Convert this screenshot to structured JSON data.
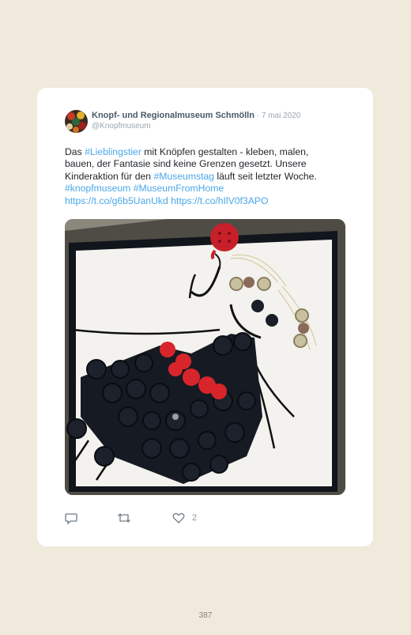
{
  "tweet": {
    "author_name": "Knopf- und Regionalmuseum Schmölln",
    "date_separator": " · ",
    "date": "7 mai 2020",
    "handle": "@Knopfmuseum",
    "text": {
      "l1_a": "Das ",
      "l1_tag": "#Lieblingstier",
      "l1_b": " mit Knöpfen gestalten - kleben, malen,",
      "l2": "bauen, der Fantasie sind keine Grenzen gesetzt. Unsere",
      "l3_a": "Kinderaktion für den ",
      "l3_tag": "#Museumstag",
      "l3_b": " läuft seit letzter Woche.",
      "l4_tag1": "#knopfmuseum",
      "l4_space": " ",
      "l4_tag2": "#MuseumFromHome",
      "l5_link1": "https://t.co/g6b5UanUkd",
      "l5_space": " ",
      "l5_link2": "https://t.co/hIlV0f3APO"
    },
    "like_count": "2",
    "icons": {
      "reply": "reply-icon",
      "retweet": "retweet-icon",
      "like": "heart-icon"
    },
    "colors": {
      "link": "#4aa8e8",
      "author": "#4a5a68",
      "muted": "#9aa7b1"
    }
  },
  "page_number": "387"
}
